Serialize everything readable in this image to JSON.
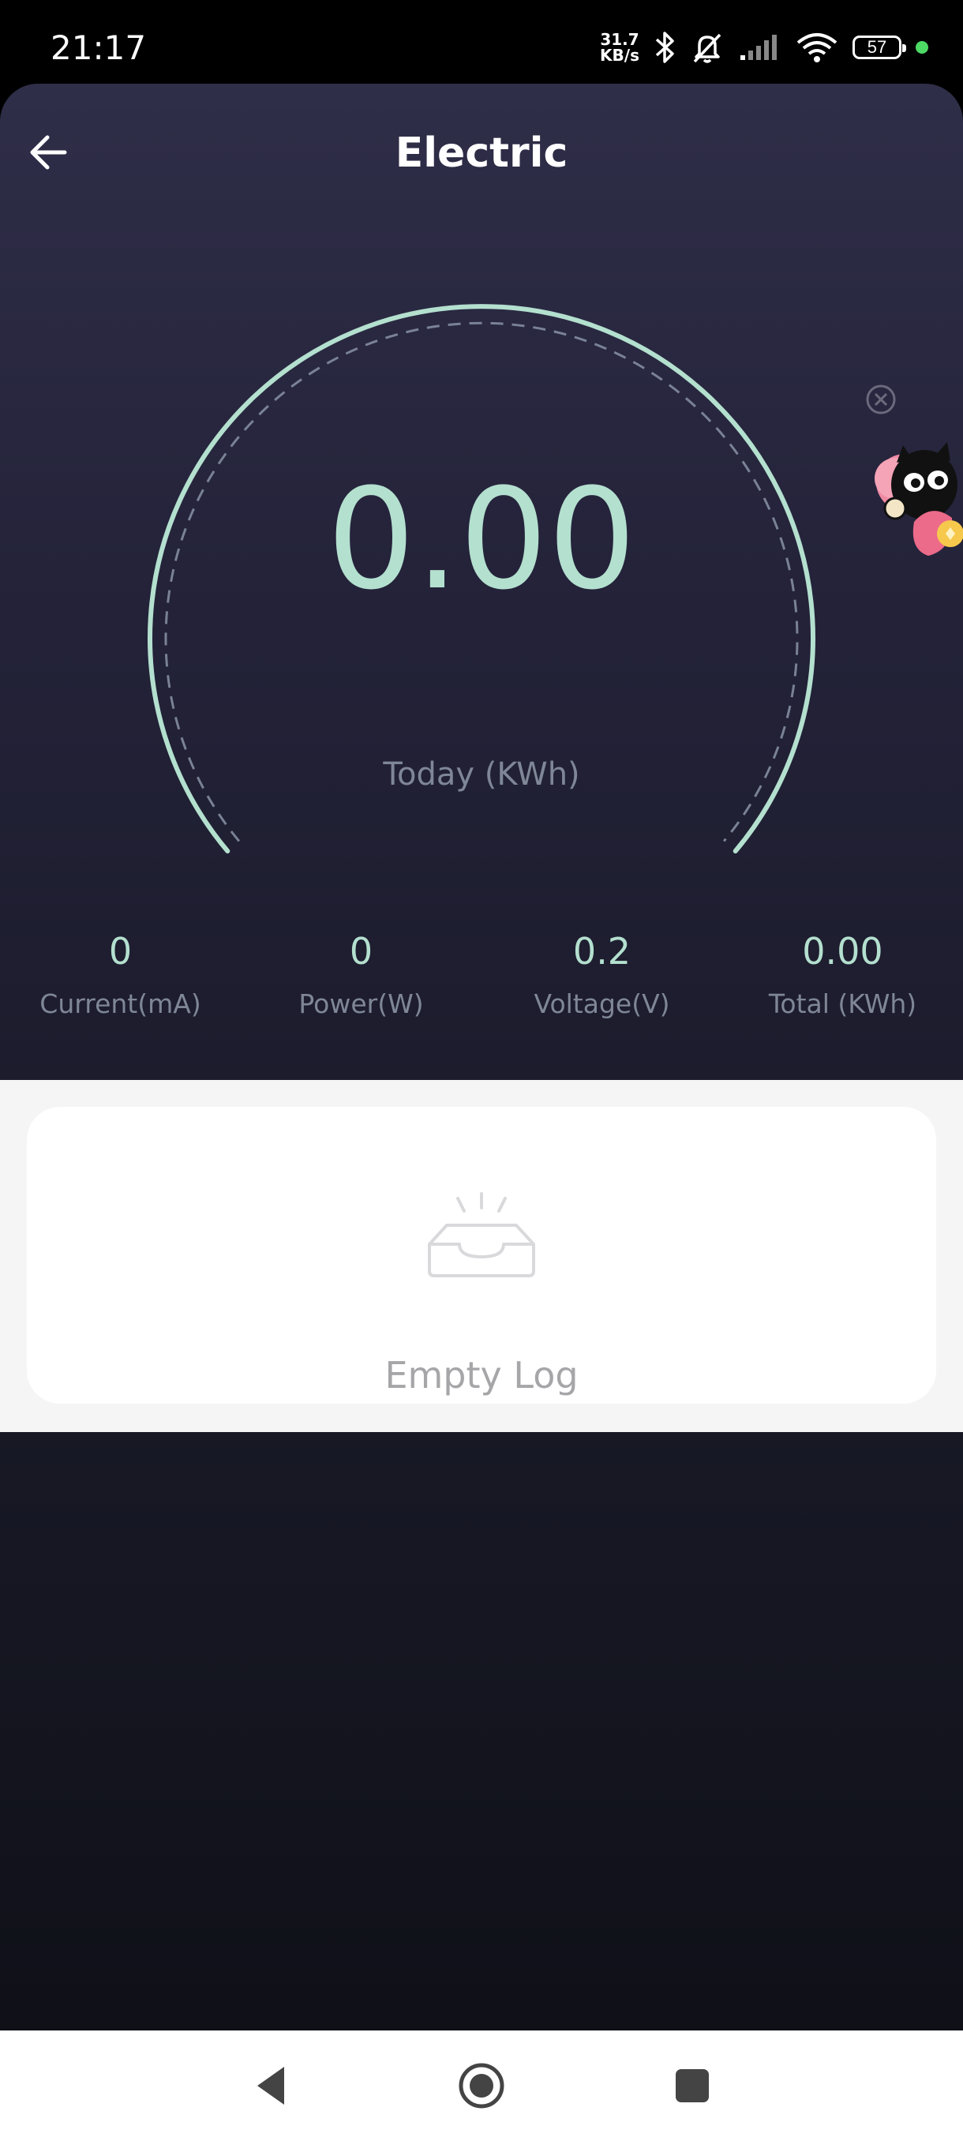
{
  "status_bar": {
    "time": "21:17",
    "net_speed_value": "31.7",
    "net_speed_unit": "KB/s",
    "battery": "57",
    "icons": [
      "bluetooth-icon",
      "mute-icon",
      "signal-icon",
      "wifi-icon",
      "battery-icon"
    ]
  },
  "header": {
    "title": "Electric",
    "back_icon": "arrow-left-icon"
  },
  "gauge": {
    "value": "0.00",
    "label": "Today (KWh)",
    "arc_color": "#b4e0cf"
  },
  "stats": [
    {
      "value": "0",
      "label": "Current(mA)"
    },
    {
      "value": "0",
      "label": "Power(W)"
    },
    {
      "value": "0.2",
      "label": "Voltage(V)"
    },
    {
      "value": "0.00",
      "label": "Total (KWh)"
    }
  ],
  "floating_widget": {
    "close_icon": "close-circle-icon",
    "mascot": "black-cat-hearts-sticker"
  },
  "log": {
    "empty_text": "Empty Log",
    "empty_icon": "empty-inbox-icon"
  },
  "nav_bar": {
    "buttons": [
      "back-triangle-icon",
      "home-circle-icon",
      "recents-square-icon"
    ]
  },
  "colors": {
    "accent": "#b4e0cf",
    "label": "#7f8797",
    "background_top": "#2f2e48",
    "background_bottom": "#0f1018"
  }
}
